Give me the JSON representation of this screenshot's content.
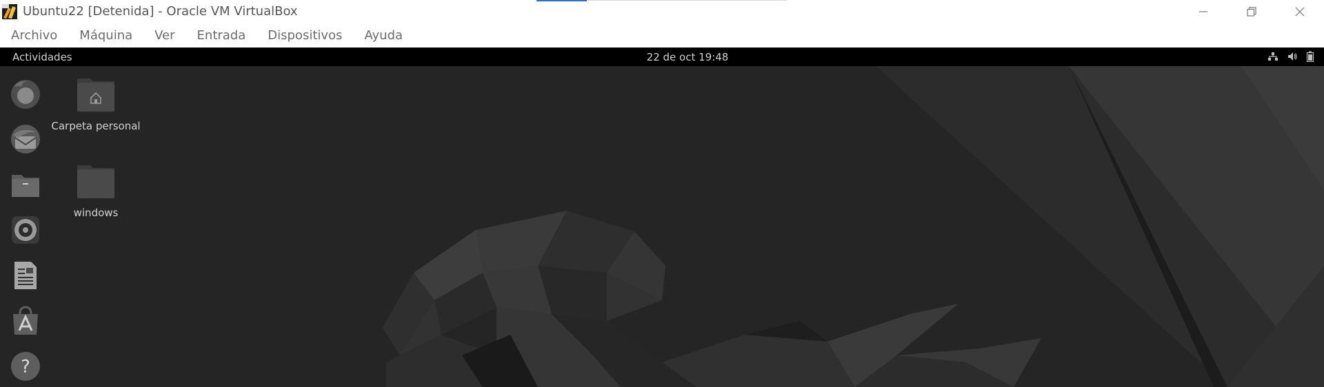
{
  "window": {
    "title": "Ubuntu22 [Detenida] - Oracle VM VirtualBox",
    "controls": [
      "minimize-icon",
      "restore-icon",
      "close-icon"
    ]
  },
  "menubar": {
    "items": [
      "Archivo",
      "Máquina",
      "Ver",
      "Entrada",
      "Dispositivos",
      "Ayuda"
    ]
  },
  "guest": {
    "topbar": {
      "activities": "Actividades",
      "clock": "22 de oct  19:48",
      "tray_icons": [
        "network-icon",
        "volume-icon",
        "battery-icon"
      ]
    },
    "dock": {
      "items": [
        "firefox-icon",
        "thunderbird-icon",
        "files-icon",
        "rhythmbox-icon",
        "writer-icon",
        "software-icon",
        "help-icon"
      ]
    },
    "desktop": {
      "icons": [
        {
          "label": "Carpeta personal",
          "icon": "home-folder-icon"
        },
        {
          "label": "windows",
          "icon": "folder-icon"
        }
      ]
    }
  },
  "colors": {
    "host_bg": "#ffffff",
    "guest_topbar": "#000000",
    "desktop_bg": "#262626",
    "accent": "#2b6fd1"
  }
}
